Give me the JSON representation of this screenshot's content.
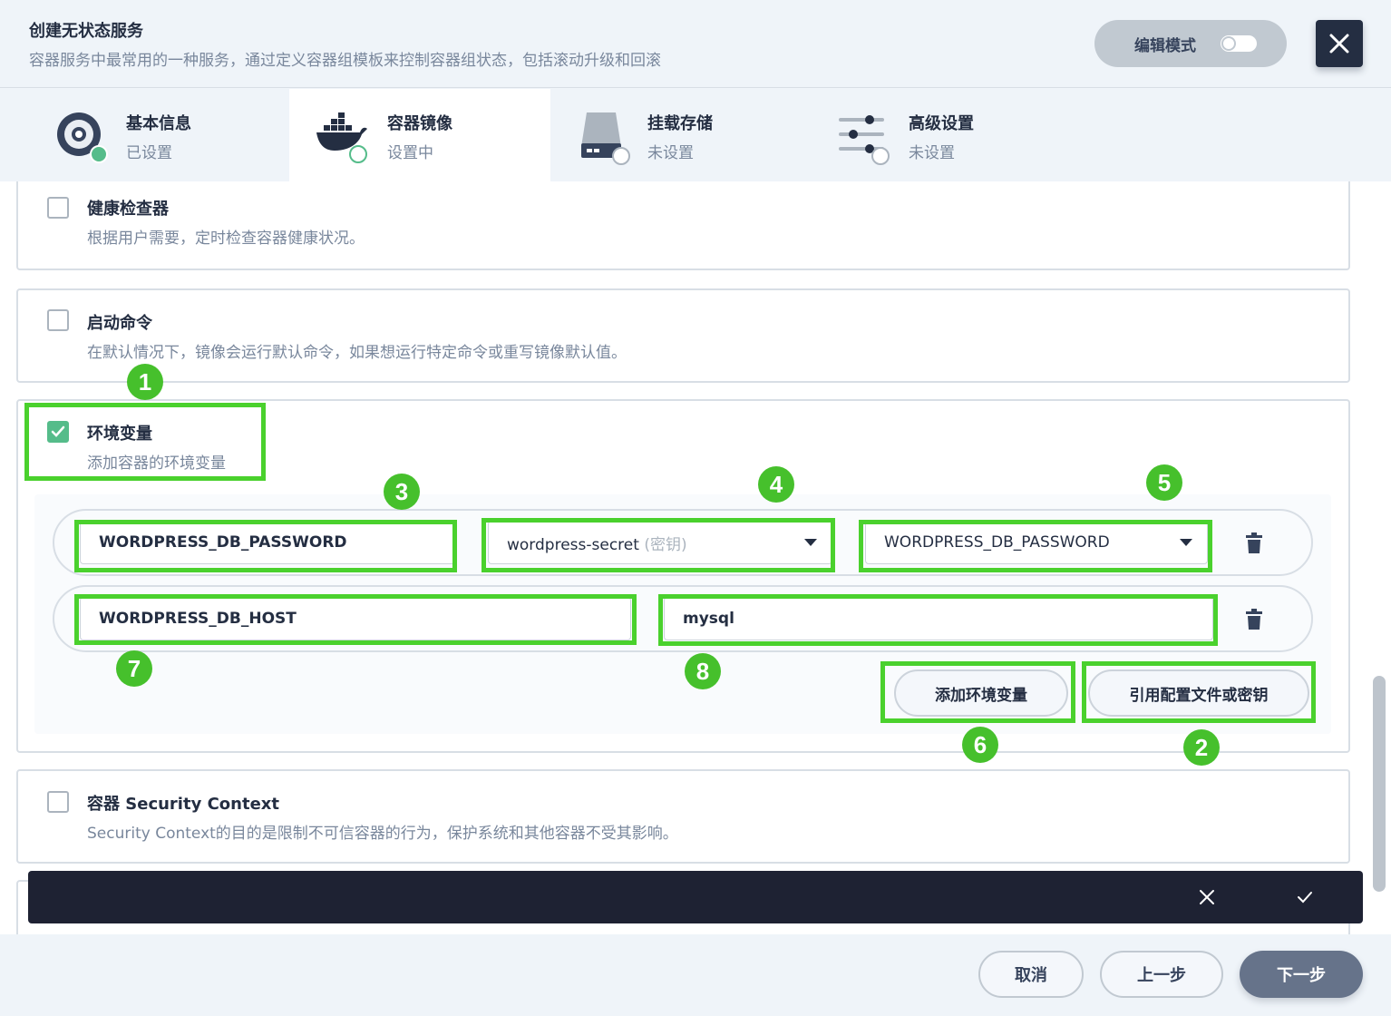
{
  "header": {
    "title": "创建无状态服务",
    "description": "容器服务中最常用的一种服务，通过定义容器组模板来控制容器组状态，包括滚动升级和回滚",
    "edit_mode_label": "编辑模式",
    "close_icon": "close-icon"
  },
  "steps": [
    {
      "title": "基本信息",
      "status": "已设置",
      "icon": "disk-icon"
    },
    {
      "title": "容器镜像",
      "status": "设置中",
      "icon": "docker-icon"
    },
    {
      "title": "挂载存储",
      "status": "未设置",
      "icon": "storage-icon"
    },
    {
      "title": "高级设置",
      "status": "未设置",
      "icon": "sliders-icon"
    }
  ],
  "cards": {
    "health": {
      "title": "健康检查器",
      "desc": "根据用户需要，定时检查容器健康状况。",
      "checked": false
    },
    "command": {
      "title": "启动命令",
      "desc": "在默认情况下，镜像会运行默认命令，如果想运行特定命令或重写镜像默认值。",
      "checked": false
    },
    "env": {
      "title": "环境变量",
      "desc": "添加容器的环境变量",
      "checked": true,
      "rows": [
        {
          "name": "WORDPRESS_DB_PASSWORD",
          "secret": "wordpress-secret",
          "secret_suffix": "(密钥)",
          "key": "WORDPRESS_DB_PASSWORD"
        },
        {
          "name": "WORDPRESS_DB_HOST",
          "value": "mysql"
        }
      ],
      "add_button": "添加环境变量",
      "ref_button": "引用配置文件或密钥"
    },
    "security": {
      "title": "容器 Security Context",
      "desc": "Security Context的目的是限制不可信容器的行为，保护系统和其他容器不受其影响。",
      "checked": false
    }
  },
  "annotations": [
    "1",
    "2",
    "3",
    "4",
    "5",
    "6",
    "7",
    "8"
  ],
  "footer": {
    "cancel": "取消",
    "prev": "上一步",
    "next": "下一步"
  },
  "colors": {
    "accent": "#55bc8a",
    "highlight": "#4ad12d",
    "dark": "#242e42"
  }
}
